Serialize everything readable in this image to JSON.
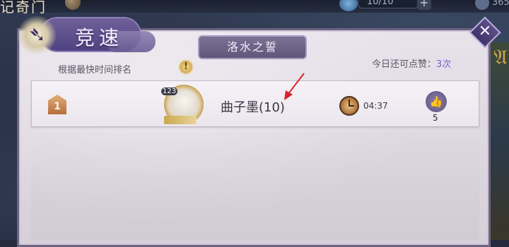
{
  "top_bar": {
    "title_fragment": "记奇门",
    "counter": "10/10",
    "plus": "+",
    "right_value": "365"
  },
  "panel": {
    "header_title": "竞速",
    "tab_label": "洛水之誓",
    "subtitle": "根据最快时间排名",
    "likes_remaining_label": "今日还可点赞：",
    "likes_remaining_value": "3次",
    "close_label": "✕"
  },
  "ranking": [
    {
      "rank": "1",
      "avatar_badge": "123",
      "name": "曲子墨(10)",
      "time": "04:37",
      "likes": "5"
    }
  ],
  "icons": {
    "info": "!",
    "like": "👍",
    "close": "close-icon"
  },
  "colors": {
    "panel_border": "#6e6482",
    "accent": "#7b5fc8",
    "arrow": "#d8242a"
  }
}
